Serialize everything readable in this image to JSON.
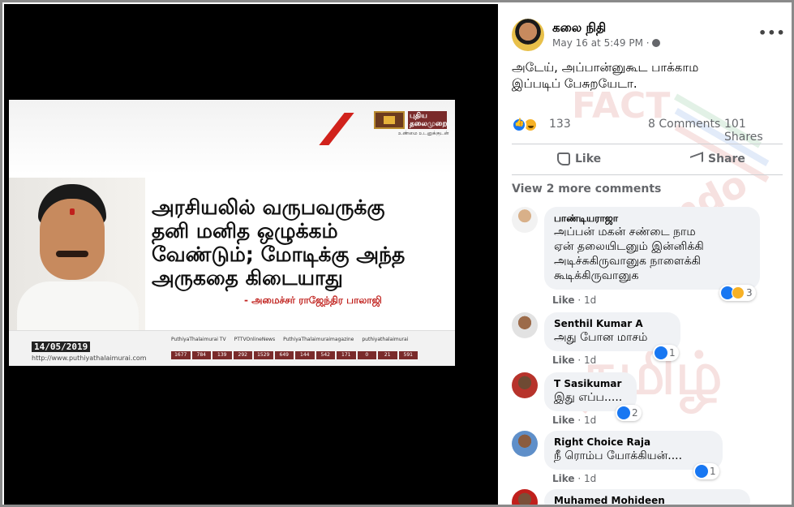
{
  "post_image": {
    "channel_name": "புதிய தலைமுறை",
    "channel_tagline": "உண்மை உடனுக்குடன்",
    "headline_lines": [
      "அரசியலில் வருபவருக்கு",
      "தனி மனித ஒழுக்கம்",
      "வேண்டும்; மோடிக்கு அந்த",
      "அருகதை கிடையாது"
    ],
    "attribution": "- அமைச்சர் ராஜேந்திர பாலாஜி",
    "date": "14/05/2019",
    "website": "http://www.puthiyathalaimurai.com",
    "social_handles": [
      "PuthiyaThalaimurai TV",
      "PTTVOnlineNews",
      "PuthiyaThalaimuraimagazine",
      "puthiyathalaimurai"
    ],
    "ticker_numbers": [
      "1677",
      "784",
      "139",
      "292",
      "1529",
      "649",
      "144",
      "542",
      "171",
      "0",
      "21",
      "591"
    ]
  },
  "post": {
    "author": "கலை நிதி",
    "time": "May 16 at 5:49 PM ·",
    "more_label": "•••",
    "text_line1": "அடேய், அப்பான்னுகூட பாக்காம",
    "text_line2": "இப்படிப் பேசுறயேடா.",
    "reaction_count": "133",
    "comments_count": "8 Comments",
    "shares_count": "101 Shares",
    "like_label": "Like",
    "share_label": "Share",
    "view_more": "View 2 more comments"
  },
  "comments": [
    {
      "name": "பாண்டியராஜா",
      "lines": [
        "அப்பன் மகன் சண்டை நாம",
        "ஏன் தலையிடனும் இன்னிக்கி",
        "அடிச்சுகிருவானுக நாளைக்கி",
        "கூடிக்கிருவானுக"
      ],
      "like": "Like",
      "time": "1d",
      "reacts": "3"
    },
    {
      "name": "Senthil Kumar A",
      "lines": [
        "அது போன மாசம்"
      ],
      "like": "Like",
      "time": "1d",
      "reacts": "1"
    },
    {
      "name": "T Sasikumar",
      "lines": [
        "இது எப்ப....."
      ],
      "like": "Like",
      "time": "1d",
      "reacts": "2"
    },
    {
      "name": "Right Choice Raja",
      "lines": [
        "நீ ரொம்ப யோக்கியன்...."
      ],
      "like": "Like",
      "time": "1d",
      "reacts": "1"
    },
    {
      "name": "Muhamed Mohideen"
    }
  ],
  "watermark": {
    "line1": "FACT",
    "line2": "crescendo",
    "line3": "தமிழ்"
  },
  "colors": {
    "fb_blue": "#1877f2",
    "haha_yellow": "#f7b125",
    "meta_gray": "#65676b",
    "bubble_gray": "#f0f2f5",
    "red": "#c0201c"
  }
}
